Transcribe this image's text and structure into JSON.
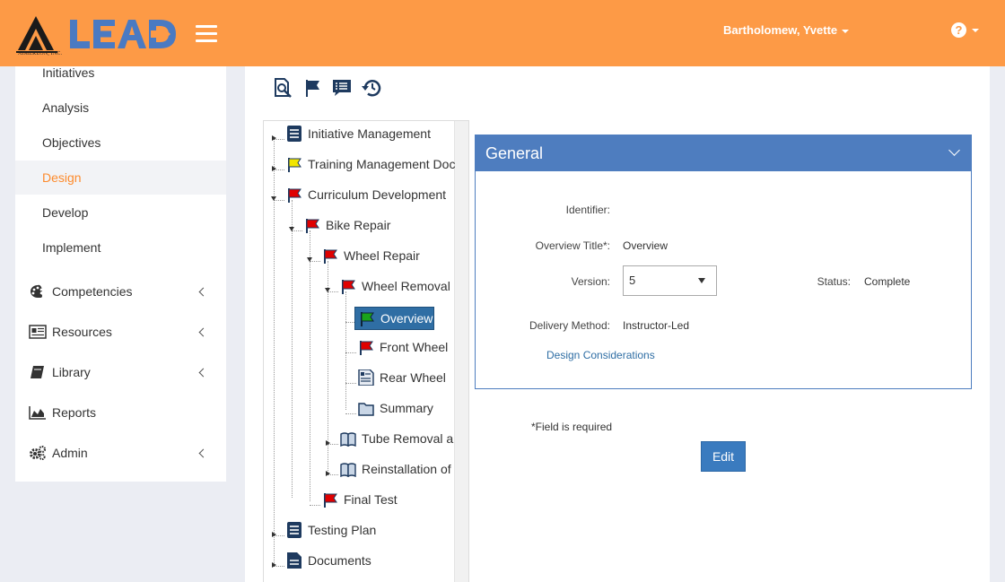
{
  "header": {
    "logo_text": "LEAD",
    "logo_company": "AIMEREON, INC.",
    "user_name": "Bartholomew, Yvette",
    "help_symbol": "?",
    "brand_color": "#fd9a46"
  },
  "sidebar": {
    "sub_items": [
      {
        "label": "Initiatives",
        "active": false
      },
      {
        "label": "Analysis",
        "active": false
      },
      {
        "label": "Objectives",
        "active": false
      },
      {
        "label": "Design",
        "active": true
      },
      {
        "label": "Develop",
        "active": false
      },
      {
        "label": "Implement",
        "active": false
      }
    ],
    "main_items": [
      {
        "label": "Competencies",
        "icon": "palette-icon",
        "has_chevron": true
      },
      {
        "label": "Resources",
        "icon": "newspaper-icon",
        "has_chevron": true
      },
      {
        "label": "Library",
        "icon": "book-icon",
        "has_chevron": true
      },
      {
        "label": "Reports",
        "icon": "area-chart-icon",
        "has_chevron": false
      },
      {
        "label": "Admin",
        "icon": "gears-icon",
        "has_chevron": true
      }
    ],
    "active_color": "#fd8b2d"
  },
  "toolbar": {
    "icons": [
      "search-document-icon",
      "flag-icon",
      "comment-list-icon",
      "history-icon"
    ]
  },
  "tree": {
    "nodes": [
      {
        "label": "Initiative Management",
        "icon": "document-list-icon"
      },
      {
        "label": "Training Management Doc",
        "icon": "yellow-flag-icon"
      },
      {
        "label": "Curriculum Development",
        "icon": "red-flag-icon"
      },
      {
        "label": "Bike Repair",
        "icon": "red-flag-icon"
      },
      {
        "label": "Wheel Repair",
        "icon": "red-flag-icon"
      },
      {
        "label": "Wheel Removal",
        "icon": "red-flag-icon"
      },
      {
        "label": "Overview",
        "icon": "green-flag-icon",
        "selected": true
      },
      {
        "label": "Front Wheel",
        "icon": "red-flag-icon"
      },
      {
        "label": "Rear Wheel",
        "icon": "form-document-icon"
      },
      {
        "label": "Summary",
        "icon": "folder-icon"
      },
      {
        "label": "Tube Removal a",
        "icon": "open-book-icon"
      },
      {
        "label": "Reinstallation of",
        "icon": "open-book-icon"
      },
      {
        "label": "Final Test",
        "icon": "red-flag-icon"
      },
      {
        "label": "Testing Plan",
        "icon": "document-list-icon"
      },
      {
        "label": "Documents",
        "icon": "document-icon"
      }
    ]
  },
  "general_panel": {
    "title": "General",
    "identifier_label": "Identifier:",
    "identifier_value": "",
    "overview_title_label": "Overview Title*:",
    "overview_title_value": "Overview",
    "version_label": "Version:",
    "version_value": "5",
    "status_label": "Status:",
    "status_value": "Complete",
    "delivery_label": "Delivery Method:",
    "delivery_value": "Instructor-Led",
    "design_link": "Design Considerations"
  },
  "form": {
    "required_note": "*Field is required",
    "edit_label": "Edit"
  }
}
